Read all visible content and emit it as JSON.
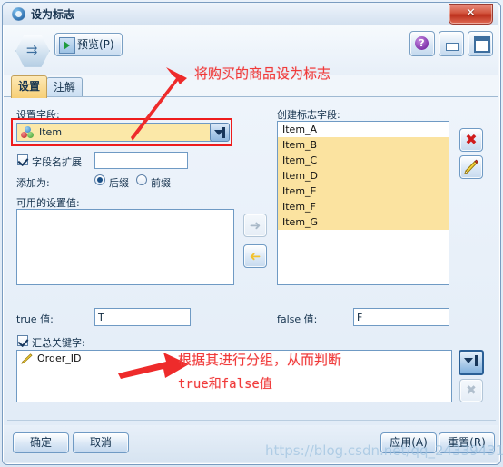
{
  "window": {
    "title": "设为标志",
    "close_label": "✕"
  },
  "toolbar": {
    "preview_label": "预览(P)",
    "help_label": "?",
    "minimize_label": "",
    "maximize_label": ""
  },
  "tabs": [
    {
      "label": "设置",
      "active": true
    },
    {
      "label": "注解",
      "active": false
    }
  ],
  "settings": {
    "set_field_label": "设置字段:",
    "set_field_value": "Item",
    "field_name_ext_label": "字段名扩展",
    "field_name_ext_value": "",
    "field_name_ext_checked": true,
    "add_as_label": "添加为:",
    "add_as_options": [
      {
        "label": "后缀",
        "selected": true
      },
      {
        "label": "前缀",
        "selected": false
      }
    ],
    "available_values_label": "可用的设置值:",
    "available_values": [],
    "true_value_label": "true 值:",
    "true_value": "T",
    "false_value_label": "false 值:",
    "false_value": "F",
    "aggregate_key_label": "汇总关键字:",
    "aggregate_key_checked": true,
    "aggregate_keys": [
      "Order_ID"
    ]
  },
  "flag_fields": {
    "label": "创建标志字段:",
    "items": [
      {
        "name": "Item_A",
        "selected": false
      },
      {
        "name": "Item_B",
        "selected": true
      },
      {
        "name": "Item_C",
        "selected": true
      },
      {
        "name": "Item_D",
        "selected": true
      },
      {
        "name": "Item_E",
        "selected": true
      },
      {
        "name": "Item_F",
        "selected": true
      },
      {
        "name": "Item_G",
        "selected": true
      }
    ],
    "delete_label": "✖",
    "edit_label": "✎"
  },
  "transfer": {
    "move_right_label": "➜",
    "move_left_label": "➜"
  },
  "annotations": [
    {
      "text": "将购买的商品设为标志"
    },
    {
      "text": "根据其进行分组，从而判断"
    },
    {
      "text": "true和false值"
    }
  ],
  "footer": {
    "ok_label": "确定",
    "cancel_label": "取消",
    "apply_label": "应用(A)",
    "reset_label": "重置(R)"
  },
  "watermark": "https://blog.csdn.net/qq_24339431",
  "colors": {
    "accent": "#1a4f86",
    "highlight": "#fbe3a0",
    "annotation": "#f03a3a",
    "field_bg": "#fbe8a8"
  }
}
